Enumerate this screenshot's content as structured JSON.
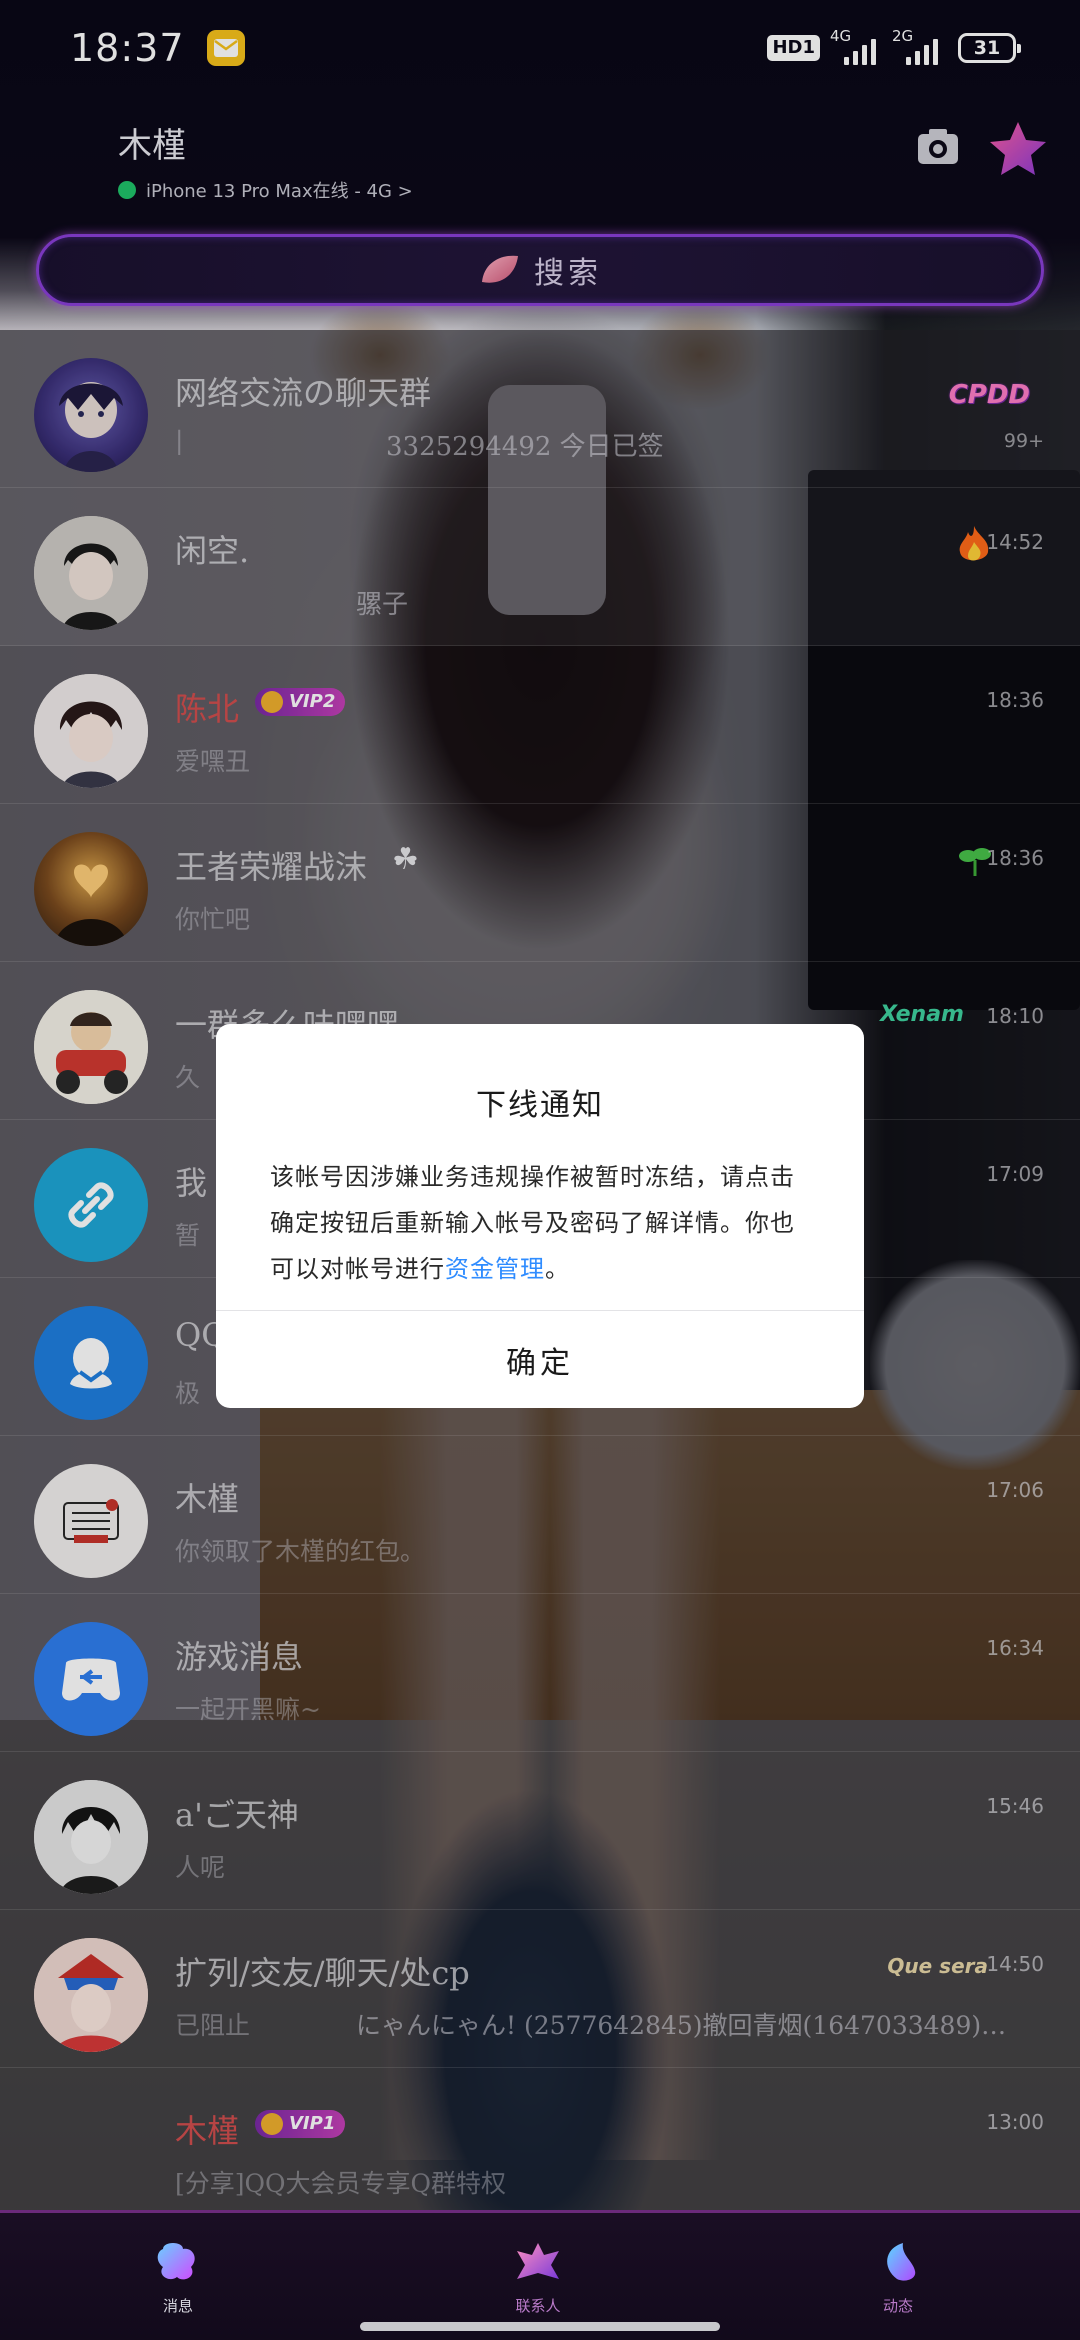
{
  "status_bar": {
    "time": "18:37",
    "hd_label": "HD1",
    "network_1": "4G",
    "network_2": "2G",
    "battery": "31"
  },
  "profile": {
    "name": "木槿",
    "status": "iPhone 13 Pro Max在线 - 4G >"
  },
  "search": {
    "label": "搜索"
  },
  "chats": [
    {
      "title": "网络交流の聊天群",
      "preview": "|",
      "preview_2": "3325294492 今日已签",
      "time": "",
      "unread": "99+",
      "badge": "CPDD"
    },
    {
      "title": "闲空.",
      "preview": "",
      "preview_2": "骡子",
      "time": "14:52"
    },
    {
      "title": "陈北",
      "vip": "VIP2",
      "preview": "爱嘿丑",
      "time": "18:36"
    },
    {
      "title": "王者荣耀战沫",
      "preview": "你忙吧",
      "time": "18:36"
    },
    {
      "title": "一群多么味嘿嘿",
      "preview": "久",
      "time": "18:10",
      "badge": "Xenam"
    },
    {
      "title": "我",
      "preview": "暂",
      "time": "17:09"
    },
    {
      "title": "QQ",
      "preview": "极",
      "time": ""
    },
    {
      "title": "木槿",
      "preview": "你领取了木槿的红包。",
      "time": "17:06"
    },
    {
      "title": "游戏消息",
      "preview": "一起开黑嘛~",
      "time": "16:34"
    },
    {
      "title": "a'ご天神",
      "preview": "人呢",
      "time": "15:46"
    },
    {
      "title": "扩列/交友/聊天/处cp",
      "preview": "已阻止",
      "preview_2": "にゃんにゃん! (2577642845)撤回青烟(1647033489)…",
      "time": "14:50",
      "badge": "Que sera"
    },
    {
      "title": "木槿",
      "vip": "VIP1",
      "preview": "[分享]QQ大会员专享Q群特权",
      "time": "13:00"
    }
  ],
  "dialog": {
    "title": "下线通知",
    "body": "该帐号因涉嫌业务违规操作被暂时冻结，请点击确定按钮后重新输入帐号及密码了解详情。你也可以对帐号进行",
    "link": "资金管理",
    "body_end": "。",
    "confirm": "确定"
  },
  "nav": {
    "messages": "消息",
    "contacts": "联系人",
    "moments": "动态"
  },
  "colors": {
    "accent": "#8a3fd8",
    "link": "#2f8cff",
    "online": "#1fc36a"
  }
}
